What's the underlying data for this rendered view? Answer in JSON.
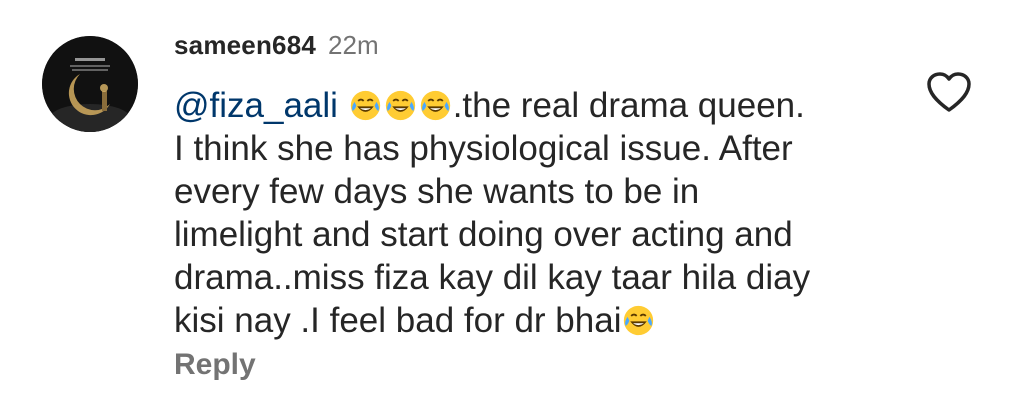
{
  "comment": {
    "username": "sameen684",
    "timestamp": "22m",
    "mention": "@fiza_aali",
    "line1_tail": ".the real drama queen.",
    "line2": "I think she has physiological issue. After",
    "line3": "every few days she wants to be in",
    "line4": "limelight and start doing over acting and",
    "line5": "drama..miss fiza kay dil kay taar hila diay",
    "line6": "kisi nay .I feel bad for dr bhai",
    "emoji": "face-with-tears-of-joy"
  },
  "actions": {
    "reply_label": "Reply",
    "like_icon": "heart-outline-icon"
  }
}
